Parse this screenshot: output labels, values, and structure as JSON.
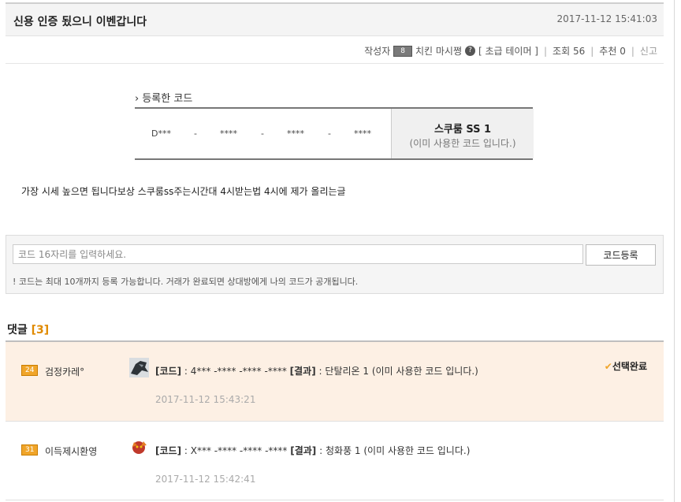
{
  "post": {
    "title": "신용 인증 됬으니 이벤갑니다",
    "date": "2017-11-12 15:41:03"
  },
  "meta": {
    "author_label": "작성자",
    "level_badge": "8",
    "author": "치킨 마시쪙",
    "help_icon": "?",
    "rank": "[ 초급 테이머 ]",
    "views_label": "조회",
    "views": "56",
    "recommend_label": "추천",
    "recommend": "0",
    "report_label": "신고"
  },
  "code_section": {
    "heading_arrow": "›",
    "heading": "등록한 코드",
    "segments": [
      "D***",
      "-",
      "****",
      "-",
      "****",
      "-",
      "****"
    ],
    "prize": "스쿠룸 SS 1",
    "status": "(이미 사용한 코드 입니다.)"
  },
  "body_text": "가장 시세 높으면 됩니다보상 스쿠룸ss주는시간대 4시받는법 4시에 제가 올리는글",
  "register": {
    "placeholder": "코드 16자리를 입력하세요.",
    "button": "코드등록",
    "note": "! 코드는 최대 10개까지 등록 가능합니다. 거래가 완료되면 상대방에게 나의 코드가 공개됩니다."
  },
  "comments_header": {
    "label": "댓글",
    "count": "[3]"
  },
  "comments": [
    {
      "level": "24",
      "user": "검정카레°",
      "code_label": "[코드]",
      "code": ": 4*** -**** -**** -****",
      "result_label": "[결과]",
      "result": ": 단탈리온 1 (이미 사용한 코드 입니다.)",
      "date": "2017-11-12 15:43:21",
      "selected_mark": "✔",
      "selected_label": "선택완료",
      "avatar_icon": "dark-dragon-avatar-icon",
      "highlight_color": "#fdf0e4"
    },
    {
      "level": "31",
      "user": "이득제시환영",
      "code_label": "[코드]",
      "code": ": X*** -**** -**** -****",
      "result_label": "[결과]",
      "result": ": 청화풍 1 (이미 사용한 코드 입니다.)",
      "date": "2017-11-12 15:42:41",
      "avatar_icon": "fire-creature-avatar-icon"
    }
  ],
  "colors": {
    "accent": "#e08a00",
    "badge": "#f0a52a"
  }
}
